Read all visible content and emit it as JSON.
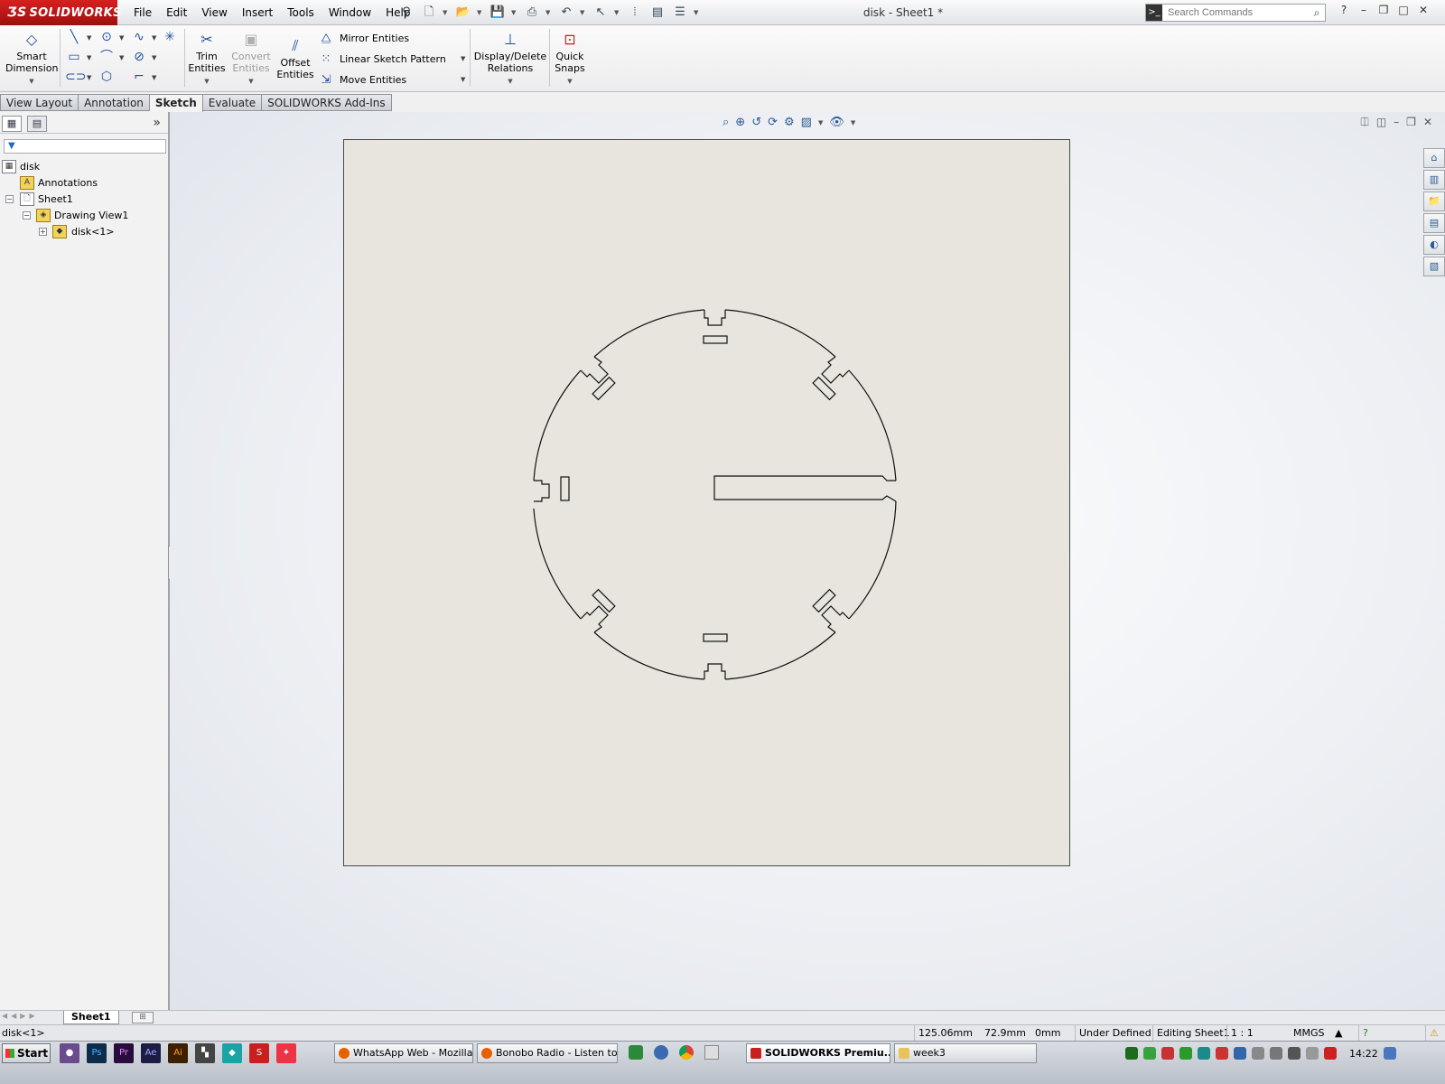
{
  "app": {
    "logo": "SOLIDWORKS",
    "document_title": "disk - Sheet1 *"
  },
  "menus": [
    "File",
    "Edit",
    "View",
    "Insert",
    "Tools",
    "Window",
    "Help"
  ],
  "search": {
    "placeholder": "Search Commands"
  },
  "ribbon": {
    "smart_dimension": [
      "Smart",
      "Dimension"
    ],
    "trim_entities": [
      "Trim",
      "Entities"
    ],
    "convert_entities": [
      "Convert",
      "Entities"
    ],
    "offset_entities": [
      "Offset",
      "Entities"
    ],
    "mirror_entities": "Mirror Entities",
    "linear_sketch_pattern": "Linear Sketch Pattern",
    "move_entities": "Move Entities",
    "display_delete_relations": [
      "Display/Delete",
      "Relations"
    ],
    "quick_snaps": [
      "Quick",
      "Snaps"
    ]
  },
  "tabs": [
    "View Layout",
    "Annotation",
    "Sketch",
    "Evaluate",
    "SOLIDWORKS Add-Ins"
  ],
  "active_tab": "Sketch",
  "tree": {
    "root": "disk",
    "annotations": "Annotations",
    "sheet": "Sheet1",
    "view": "Drawing View1",
    "part": "disk<1>"
  },
  "sheet_tab": "Sheet1",
  "status": {
    "selection": "disk<1>",
    "x": "125.06mm",
    "y": "72.9mm",
    "z": "0mm",
    "definition": "Under Defined",
    "editing": "Editing Sheet1",
    "scale": "1 : 1",
    "units": "MMGS"
  },
  "taskbar": {
    "start": "Start",
    "quick_launch": [
      "Ps",
      "Pr",
      "Ae",
      "Ai"
    ],
    "windows": [
      {
        "label": "WhatsApp Web - Mozilla ...",
        "color": "#e66000"
      },
      {
        "label": "Bonobo Radio - Listen to ...",
        "color": "#e66000"
      },
      {
        "label": "SOLIDWORKS Premiu...",
        "color": "#c8201f"
      },
      {
        "label": "week3",
        "color": "#e8c35a"
      }
    ],
    "clock": "14:22"
  }
}
